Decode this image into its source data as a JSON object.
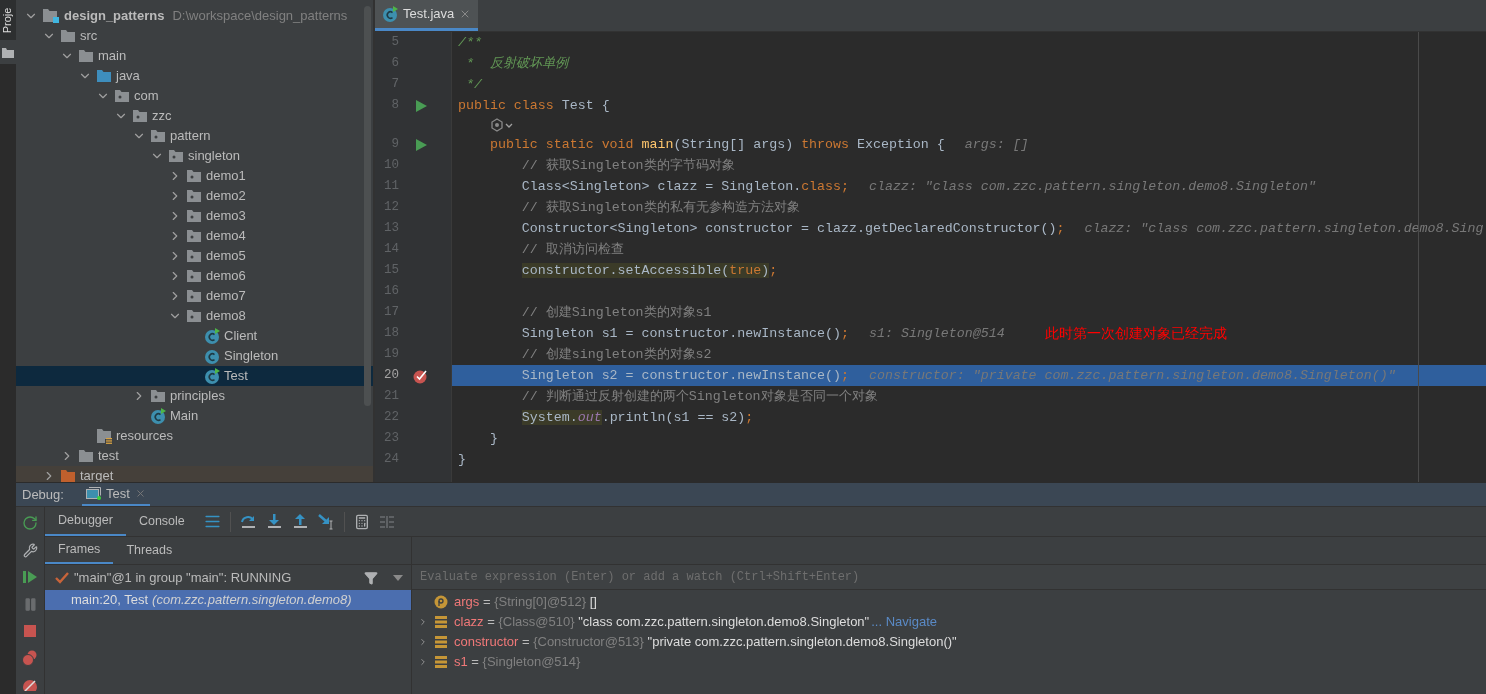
{
  "sidebar_tab": "Proje",
  "project": {
    "tree": [
      {
        "name": "design_patterns",
        "path": "D:\\workspace\\design_patterns",
        "kind": "module",
        "expanded": true,
        "selected": false,
        "children": [
          {
            "name": "src",
            "kind": "folder",
            "expanded": true,
            "selected": false,
            "children": [
              {
                "name": "main",
                "kind": "folder",
                "expanded": true,
                "selected": false,
                "children": [
                  {
                    "name": "java",
                    "kind": "source",
                    "expanded": true,
                    "selected": false,
                    "children": [
                      {
                        "name": "com",
                        "kind": "package",
                        "expanded": true,
                        "selected": false,
                        "children": [
                          {
                            "name": "zzc",
                            "kind": "package",
                            "expanded": true,
                            "selected": false,
                            "children": [
                              {
                                "name": "pattern",
                                "kind": "package",
                                "expanded": true,
                                "selected": false,
                                "children": [
                                  {
                                    "name": "singleton",
                                    "kind": "package",
                                    "expanded": true,
                                    "selected": false,
                                    "children": [
                                      {
                                        "name": "demo1",
                                        "kind": "package",
                                        "expanded": false,
                                        "selected": false
                                      },
                                      {
                                        "name": "demo2",
                                        "kind": "package",
                                        "expanded": false,
                                        "selected": false
                                      },
                                      {
                                        "name": "demo3",
                                        "kind": "package",
                                        "expanded": false,
                                        "selected": false
                                      },
                                      {
                                        "name": "demo4",
                                        "kind": "package",
                                        "expanded": false,
                                        "selected": false
                                      },
                                      {
                                        "name": "demo5",
                                        "kind": "package",
                                        "expanded": false,
                                        "selected": false
                                      },
                                      {
                                        "name": "demo6",
                                        "kind": "package",
                                        "expanded": false,
                                        "selected": false
                                      },
                                      {
                                        "name": "demo7",
                                        "kind": "package",
                                        "expanded": false,
                                        "selected": false
                                      },
                                      {
                                        "name": "demo8",
                                        "kind": "package",
                                        "expanded": true,
                                        "selected": false,
                                        "children": [
                                          {
                                            "name": "Client",
                                            "kind": "class-run",
                                            "selected": false
                                          },
                                          {
                                            "name": "Singleton",
                                            "kind": "class",
                                            "selected": false
                                          },
                                          {
                                            "name": "Test",
                                            "kind": "class-run",
                                            "selected": true
                                          }
                                        ]
                                      }
                                    ]
                                  }
                                ]
                              },
                              {
                                "name": "principles",
                                "kind": "package",
                                "expanded": false,
                                "selected": false
                              },
                              {
                                "name": "Main",
                                "kind": "class-run",
                                "selected": false
                              }
                            ]
                          }
                        ]
                      }
                    ]
                  },
                  {
                    "name": "resources",
                    "kind": "resources",
                    "selected": false
                  }
                ]
              },
              {
                "name": "test",
                "kind": "folder",
                "expanded": false,
                "selected": false
              }
            ]
          },
          {
            "name": "target",
            "kind": "excluded",
            "expanded": false,
            "selected": false
          }
        ]
      }
    ]
  },
  "editor": {
    "tabs": [
      {
        "label": "Test.java",
        "selected": true
      }
    ],
    "lines": [
      {
        "kind": "code",
        "number": "5",
        "selected": false,
        "tokens": [
          {
            "kind": "doc",
            "text": "/**"
          }
        ]
      },
      {
        "kind": "code",
        "number": "6",
        "selected": false,
        "tokens": [
          {
            "kind": "doc",
            "text": " *  反射破坏单例"
          }
        ]
      },
      {
        "kind": "code",
        "number": "7",
        "selected": false,
        "tokens": [
          {
            "kind": "doc",
            "text": " */"
          }
        ]
      },
      {
        "kind": "runnable",
        "number": "8",
        "selected": false,
        "tokens": [
          {
            "kind": "keyword",
            "text": "public class "
          },
          {
            "kind": "plain",
            "text": "Test {"
          }
        ]
      },
      {
        "kind": "inlay"
      },
      {
        "kind": "runnable",
        "number": "9",
        "selected": false,
        "tokens": [
          {
            "kind": "keyword",
            "text": "    public static void "
          },
          {
            "kind": "method",
            "text": "main"
          },
          {
            "kind": "plain",
            "text": "(String[] args) "
          },
          {
            "kind": "keyword",
            "text": "throws "
          },
          {
            "kind": "plain",
            "text": "Exception {"
          }
        ],
        "hint": "args: []"
      },
      {
        "kind": "code",
        "number": "10",
        "selected": false,
        "tokens": [
          {
            "kind": "comment",
            "text": "        // 获取Singleton类的字节码对象"
          }
        ]
      },
      {
        "kind": "code",
        "number": "11",
        "selected": false,
        "tokens": [
          {
            "kind": "plain",
            "text": "        Class<Singleton> clazz = Singleton."
          },
          {
            "kind": "keyword",
            "text": "class;"
          }
        ],
        "hint": "clazz: \"class com.zzc.pattern.singleton.demo8.Singleton\""
      },
      {
        "kind": "code",
        "number": "12",
        "selected": false,
        "tokens": [
          {
            "kind": "comment",
            "text": "        // 获取Singleton类的私有无参构造方法对象"
          }
        ]
      },
      {
        "kind": "code",
        "number": "13",
        "selected": false,
        "tokens": [
          {
            "kind": "plain",
            "text": "        Constructor<Singleton> constructor = clazz.getDeclaredConstructor()"
          },
          {
            "kind": "keyword",
            "text": ";"
          }
        ],
        "hint": "clazz: \"class com.zzc.pattern.singleton.demo8.Sing"
      },
      {
        "kind": "code",
        "number": "14",
        "selected": false,
        "tokens": [
          {
            "kind": "comment",
            "text": "        // 取消访问检查"
          }
        ]
      },
      {
        "kind": "code",
        "number": "15",
        "selected": false,
        "tokens": [
          {
            "kind": "marked-plain",
            "text": "        constructor.setAccessible("
          },
          {
            "kind": "marked-keyword",
            "text": "true"
          },
          {
            "kind": "marked-plain",
            "text": ")"
          },
          {
            "kind": "keyword",
            "text": ";"
          }
        ]
      },
      {
        "kind": "code",
        "number": "16",
        "selected": false
      },
      {
        "kind": "code",
        "number": "17",
        "selected": false,
        "tokens": [
          {
            "kind": "comment",
            "text": "        // 创建Singleton类的对象s1"
          }
        ]
      },
      {
        "kind": "code",
        "number": "18",
        "selected": false,
        "tokens": [
          {
            "kind": "plain",
            "text": "        Singleton s1 = constructor.newInstance()"
          },
          {
            "kind": "keyword",
            "text": ";"
          }
        ],
        "hint": "s1: Singleton@514",
        "note": "此时第一次创建对象已经完成"
      },
      {
        "kind": "code",
        "number": "19",
        "selected": false,
        "tokens": [
          {
            "kind": "comment",
            "text": "        // 创建singleton类的对象s2"
          }
        ]
      },
      {
        "kind": "breakpoint",
        "number": "20",
        "selected": true,
        "tokens": [
          {
            "kind": "plain",
            "text": "        Singleton s2 = constructor.newInstance()"
          },
          {
            "kind": "keyword",
            "text": ";"
          }
        ],
        "hint": "constructor: \"private com.zzc.pattern.singleton.demo8.Singleton()\""
      },
      {
        "kind": "code",
        "number": "21",
        "selected": false,
        "tokens": [
          {
            "kind": "comment",
            "text": "        // 判断通过反射创建的两个Singleton对象是否同一个对象"
          }
        ]
      },
      {
        "kind": "code",
        "number": "22",
        "selected": false,
        "tokens": [
          {
            "kind": "marked-plain",
            "text": "        System."
          },
          {
            "kind": "marked-static-field",
            "text": "out"
          },
          {
            "kind": "plain",
            "text": ".println(s1 == s2)"
          },
          {
            "kind": "keyword",
            "text": ";"
          }
        ]
      },
      {
        "kind": "code",
        "number": "23",
        "selected": false,
        "tokens": [
          {
            "kind": "plain",
            "text": "    }"
          }
        ]
      },
      {
        "kind": "code",
        "number": "24",
        "selected": false,
        "tokens": [
          {
            "kind": "plain",
            "text": "}"
          }
        ]
      }
    ]
  },
  "debug": {
    "label": "Debug:",
    "tabs": [
      {
        "label": "Test",
        "selected": true
      }
    ],
    "side_buttons": [
      {
        "kind": "rerun",
        "disabled": false
      },
      {
        "kind": "settings",
        "disabled": false
      },
      {
        "kind": "resume",
        "disabled": false
      },
      {
        "kind": "pause",
        "disabled": true
      },
      {
        "kind": "stop",
        "disabled": false
      },
      {
        "kind": "breakpoints",
        "disabled": false
      },
      {
        "kind": "mute",
        "disabled": false
      }
    ],
    "tool_tabs": [
      {
        "label": "Debugger",
        "selected": true
      },
      {
        "label": "Console",
        "selected": false
      }
    ],
    "frame_tabs": [
      {
        "label": "Frames",
        "selected": true
      },
      {
        "label": "Threads",
        "selected": false
      }
    ],
    "thread": "\"main\"@1 in group \"main\": RUNNING",
    "frames": [
      {
        "text": "main:20, Test",
        "location": "(com.zzc.pattern.singleton.demo8)",
        "selected": true
      }
    ],
    "evaluate": {
      "placeholder": "Evaluate expression (Enter) or add a watch (Ctrl+Shift+Enter)"
    },
    "variables": [
      {
        "kind": "param",
        "name": "args",
        "operator": "=",
        "type": "{String[0]@512}",
        "value": "[]"
      },
      {
        "kind": "field",
        "name": "clazz",
        "operator": "=",
        "type": "{Class@510}",
        "value": "\"class com.zzc.pattern.singleton.demo8.Singleton\"",
        "link": "... Navigate",
        "expanded": false
      },
      {
        "kind": "field",
        "name": "constructor",
        "operator": "=",
        "type": "{Constructor@513}",
        "value": "\"private com.zzc.pattern.singleton.demo8.Singleton()\"",
        "expanded": false
      },
      {
        "kind": "field",
        "name": "s1",
        "operator": "=",
        "type": "{Singleton@514}",
        "expanded": false
      }
    ]
  }
}
